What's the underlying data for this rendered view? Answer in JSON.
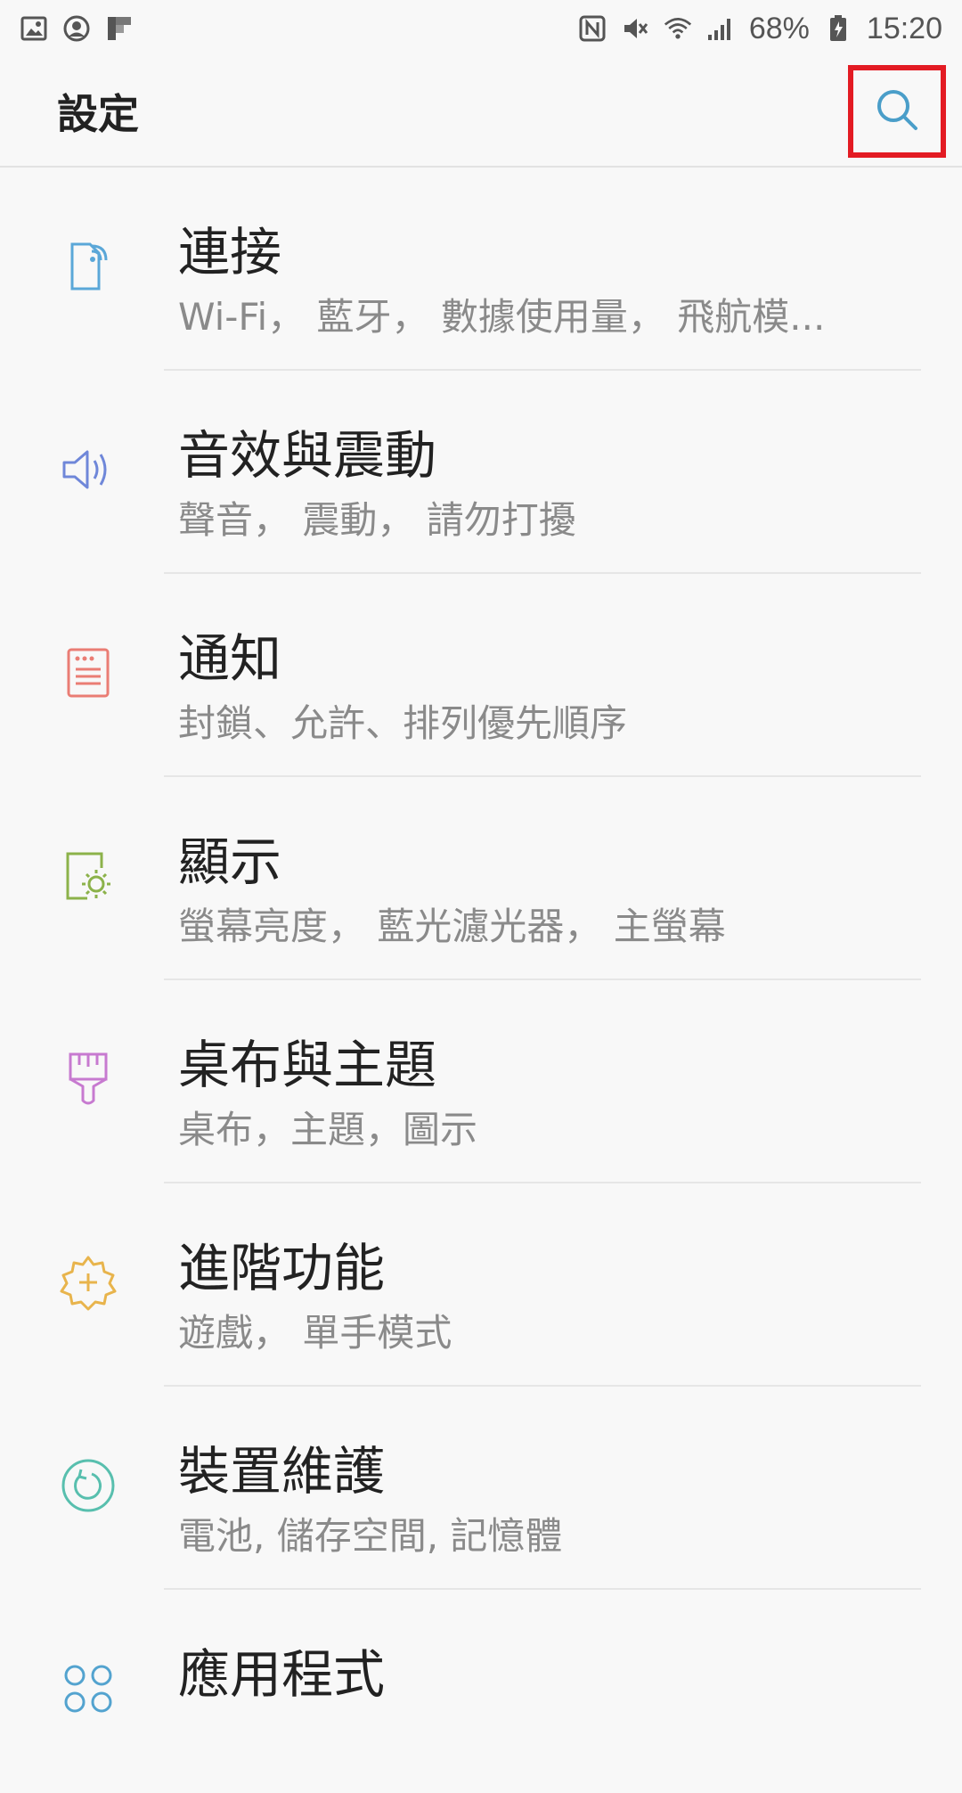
{
  "status_bar": {
    "battery": "68%",
    "time": "15:20"
  },
  "app_bar": {
    "title": "設定"
  },
  "items": [
    {
      "title": "連接",
      "subtitle": "Wi-Fi， 藍牙， 數據使用量， 飛航模...",
      "icon": "connections-icon",
      "color": "#5aa7d8"
    },
    {
      "title": "音效與震動",
      "subtitle": "聲音， 震動， 請勿打擾",
      "icon": "speaker-icon",
      "color": "#6f87d9"
    },
    {
      "title": "通知",
      "subtitle": "封鎖、允許、排列優先順序",
      "icon": "notifications-icon",
      "color": "#ea7d74"
    },
    {
      "title": "顯示",
      "subtitle": "螢幕亮度， 藍光濾光器， 主螢幕",
      "icon": "display-brightness-icon",
      "color": "#8cb24a"
    },
    {
      "title": "桌布與主題",
      "subtitle": "桌布，主題，圖示",
      "icon": "paintbrush-icon",
      "color": "#c77ad0"
    },
    {
      "title": "進階功能",
      "subtitle": "遊戲， 單手模式",
      "icon": "advanced-gear-icon",
      "color": "#e8b44c"
    },
    {
      "title": "裝置維護",
      "subtitle": "電池, 儲存空間, 記憶體",
      "icon": "device-care-icon",
      "color": "#58bfae"
    },
    {
      "title": "應用程式",
      "subtitle": "",
      "icon": "apps-icon",
      "color": "#53a3cf"
    }
  ]
}
